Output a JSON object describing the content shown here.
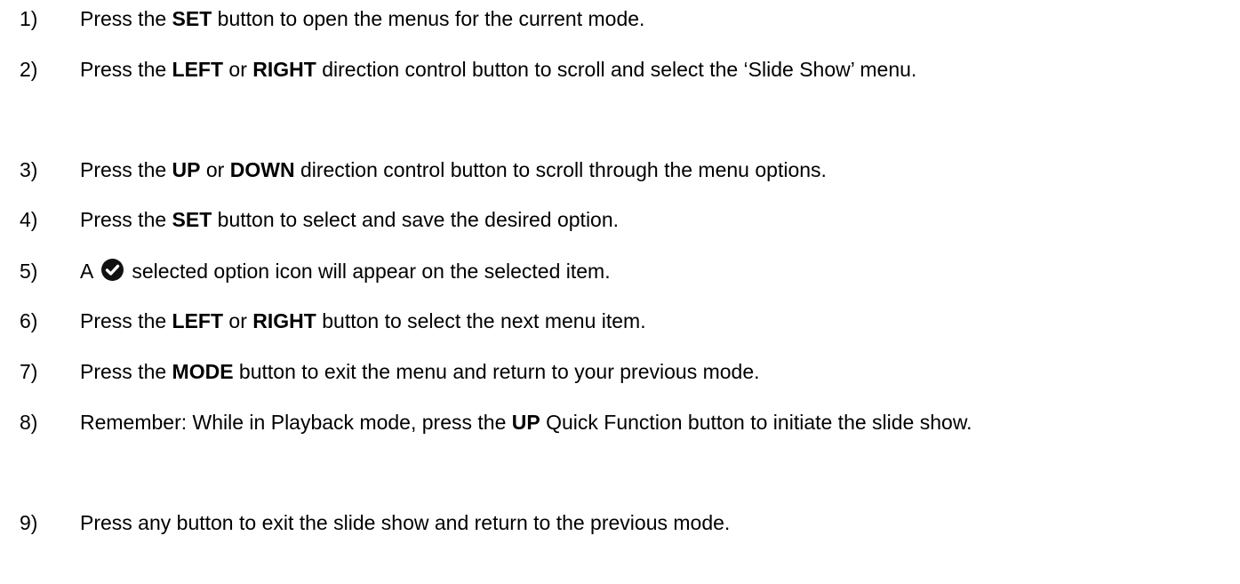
{
  "steps": [
    {
      "number": "1)",
      "parts": [
        {
          "text": "Press the ",
          "bold": false
        },
        {
          "text": "SET",
          "bold": true
        },
        {
          "text": " button to open the menus for the current mode.",
          "bold": false
        }
      ]
    },
    {
      "number": "2)",
      "parts": [
        {
          "text": "Press the ",
          "bold": false
        },
        {
          "text": "LEFT",
          "bold": true
        },
        {
          "text": " or ",
          "bold": false
        },
        {
          "text": "RIGHT",
          "bold": true
        },
        {
          "text": " direction control button to scroll and select the ‘Slide Show’ menu.",
          "bold": false
        }
      ]
    },
    {
      "number": "3)",
      "parts": [
        {
          "text": "Press the ",
          "bold": false
        },
        {
          "text": "UP",
          "bold": true
        },
        {
          "text": " or ",
          "bold": false
        },
        {
          "text": "DOWN",
          "bold": true
        },
        {
          "text": " direction control button to scroll through the menu options.",
          "bold": false
        }
      ]
    },
    {
      "number": "4)",
      "parts": [
        {
          "text": "Press the ",
          "bold": false
        },
        {
          "text": "SET",
          "bold": true
        },
        {
          "text": " button to select and save the desired option.",
          "bold": false
        }
      ]
    },
    {
      "number": "5)",
      "parts": [
        {
          "text": "A",
          "bold": false
        },
        {
          "icon": "check-circle-icon"
        },
        {
          "text": "selected option icon will appear on the selected item.",
          "bold": false
        }
      ]
    },
    {
      "number": "6)",
      "parts": [
        {
          "text": "Press the ",
          "bold": false
        },
        {
          "text": "LEFT",
          "bold": true
        },
        {
          "text": " or ",
          "bold": false
        },
        {
          "text": "RIGHT",
          "bold": true
        },
        {
          "text": " button to select the next menu item.",
          "bold": false
        }
      ]
    },
    {
      "number": "7)",
      "parts": [
        {
          "text": "Press the ",
          "bold": false
        },
        {
          "text": "MODE",
          "bold": true
        },
        {
          "text": " button to exit the menu and return to your previous mode.",
          "bold": false
        }
      ]
    },
    {
      "number": "8)",
      "parts": [
        {
          "text": "Remember: While in Playback mode, press the ",
          "bold": false
        },
        {
          "text": "UP",
          "bold": true
        },
        {
          "text": " Quick Function button to initiate the slide show.",
          "bold": false
        }
      ]
    },
    {
      "number": "9)",
      "parts": [
        {
          "text": "Press any button to exit the slide show and return to the previous mode.",
          "bold": false
        }
      ]
    }
  ]
}
